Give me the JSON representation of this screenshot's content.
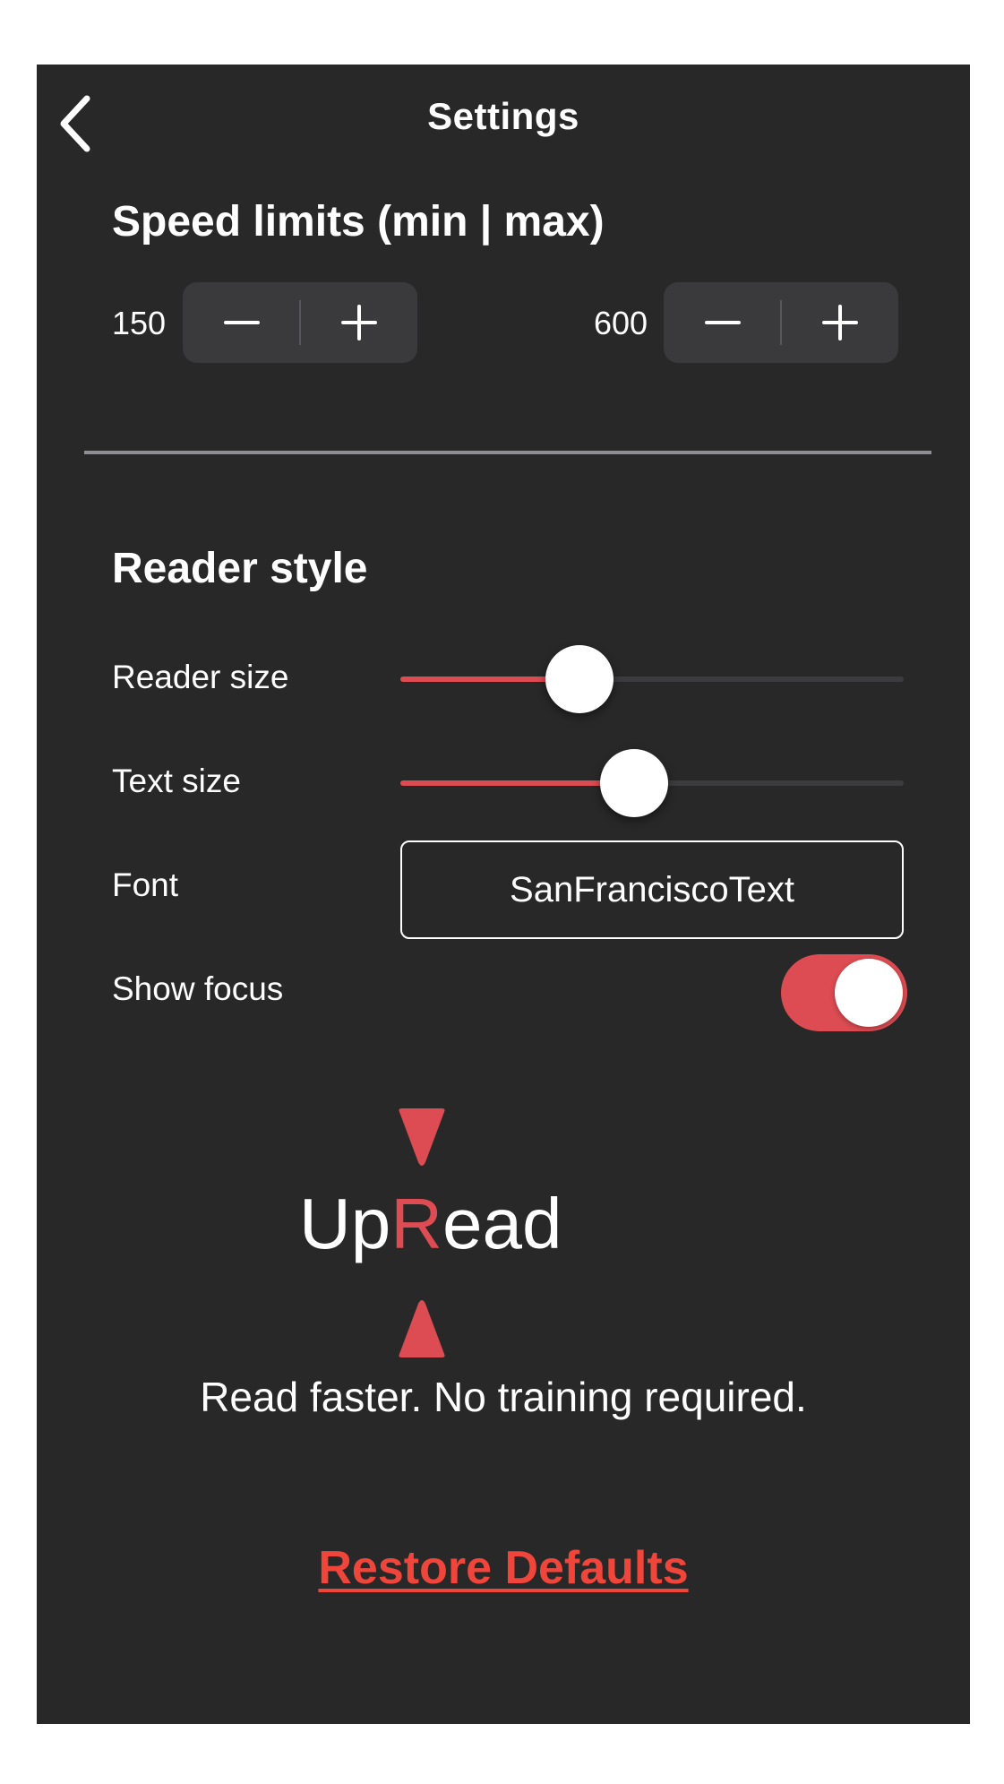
{
  "header": {
    "title": "Settings",
    "back_icon": "chevron-left-icon"
  },
  "speed_limits": {
    "title": "Speed limits (min | max)",
    "min": "150",
    "max": "600",
    "decrement_icon": "minus-icon",
    "increment_icon": "plus-icon"
  },
  "reader_style": {
    "title": "Reader style",
    "reader_size_label": "Reader size",
    "reader_size_fraction": 0.355,
    "text_size_label": "Text size",
    "text_size_fraction": 0.465,
    "font_label": "Font",
    "font_value": "SanFranciscoText",
    "show_focus_label": "Show focus",
    "show_focus_on": true
  },
  "preview": {
    "word_before": "Up",
    "word_focus": "R",
    "word_after": "ead",
    "marker_icon_top": "triangle-down-icon",
    "marker_icon_bottom": "triangle-up-icon",
    "tagline": "Read faster. No training required."
  },
  "restore_label": "Restore Defaults",
  "colors": {
    "background": "#282828",
    "accent": "#dc4c52",
    "link": "#f0453a",
    "stepper_bg": "#3a3a3c"
  }
}
